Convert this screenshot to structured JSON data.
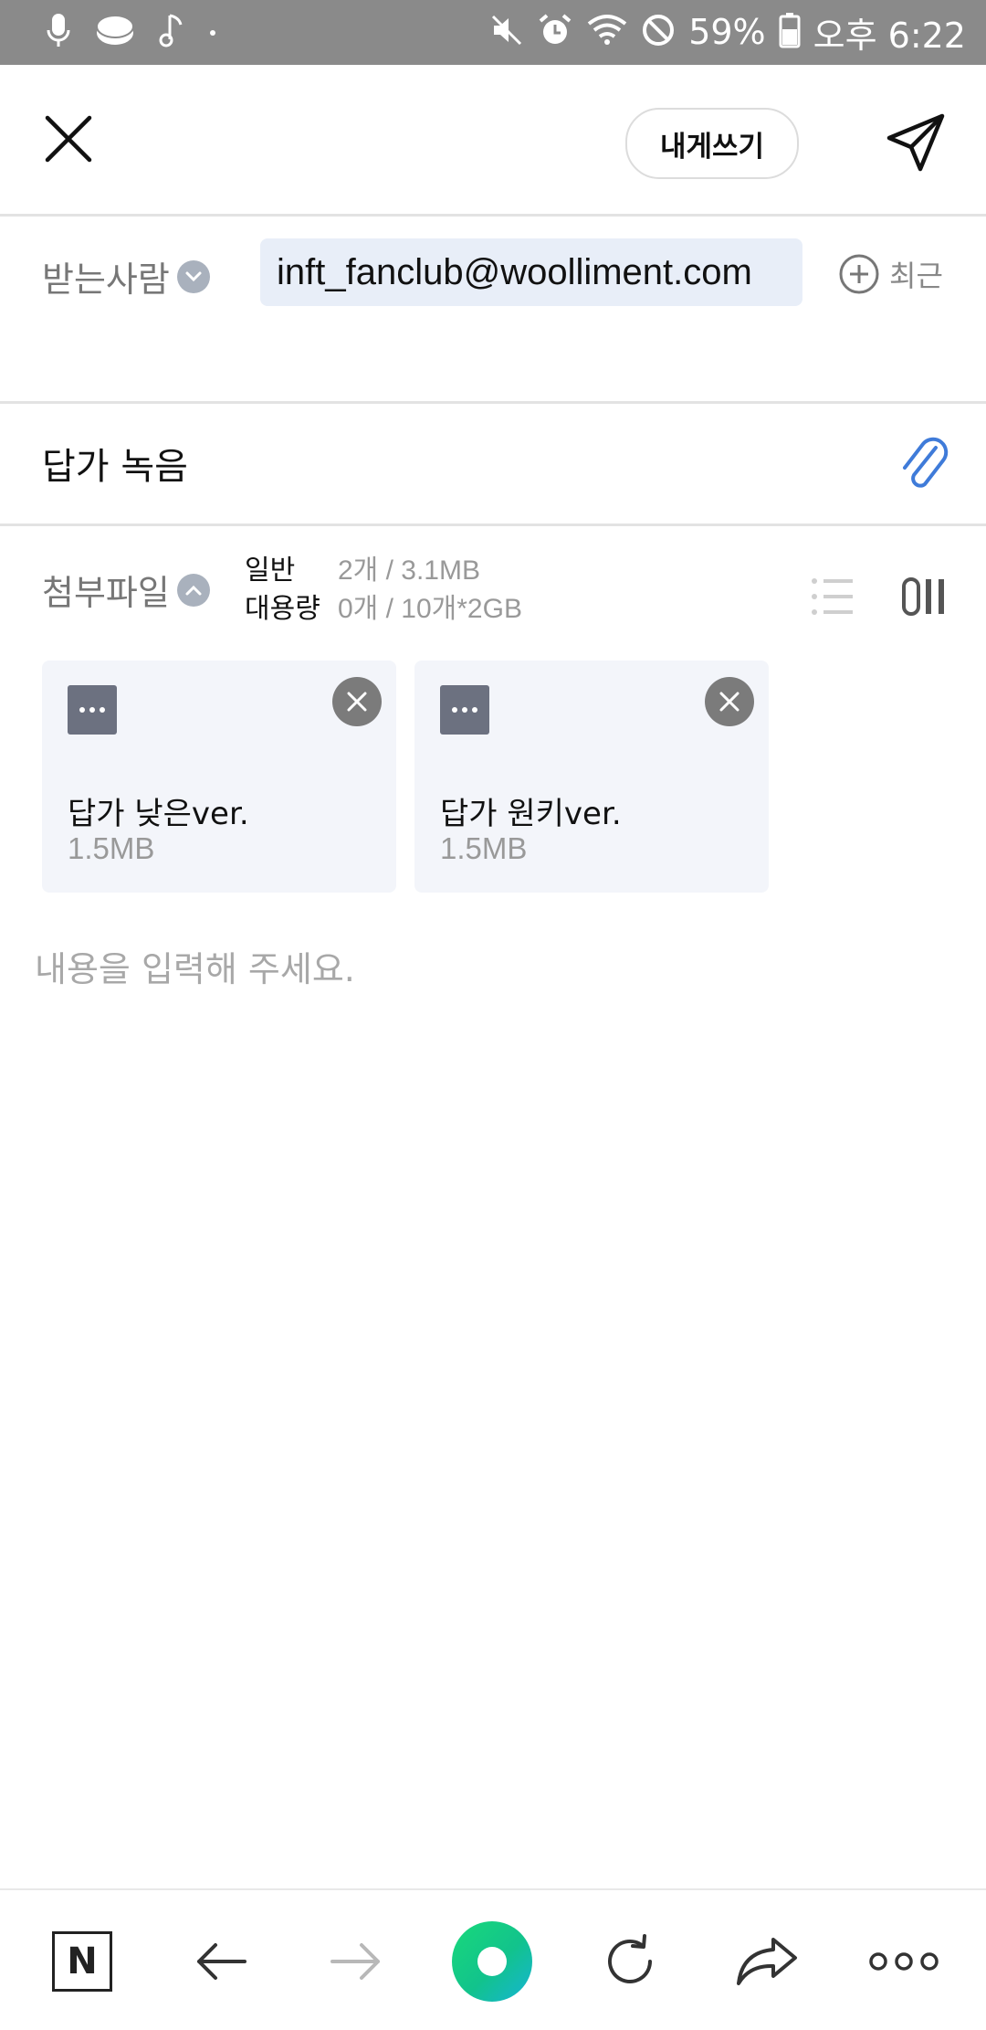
{
  "status_bar": {
    "battery": "59%",
    "time": "오후 6:22",
    "left_icons": [
      "mic-icon",
      "coin-icon",
      "music-note-icon",
      "dot-icon"
    ],
    "right_icons": [
      "mute-icon",
      "alarm-icon",
      "wifi-icon",
      "do-not-disturb-icon",
      "battery-icon"
    ]
  },
  "toolbar": {
    "self_label": "내게쓰기"
  },
  "recipient": {
    "label": "받는사람",
    "email": "inft_fanclub@woolliment.com",
    "recent_label": "최근"
  },
  "subject": {
    "value": "답가 녹음"
  },
  "attachments": {
    "label": "첨부파일",
    "normal_label": "일반",
    "normal_value": "2개 / 3.1MB",
    "large_label": "대용량",
    "large_value": "0개 / 10개*2GB",
    "files": [
      {
        "name": "답가 낮은ver.",
        "size": "1.5MB"
      },
      {
        "name": "답가 원키ver.",
        "size": "1.5MB"
      }
    ]
  },
  "body": {
    "placeholder": "내용을 입력해 주세요."
  },
  "bottom_nav": {
    "logo_letter": "N"
  },
  "colors": {
    "status_bar": "#8a8a8a",
    "chip_bg": "#e8eef8",
    "card_bg": "#f3f5fa",
    "clip_blue": "#3f7bd9",
    "orb_green": "#12c38c"
  }
}
